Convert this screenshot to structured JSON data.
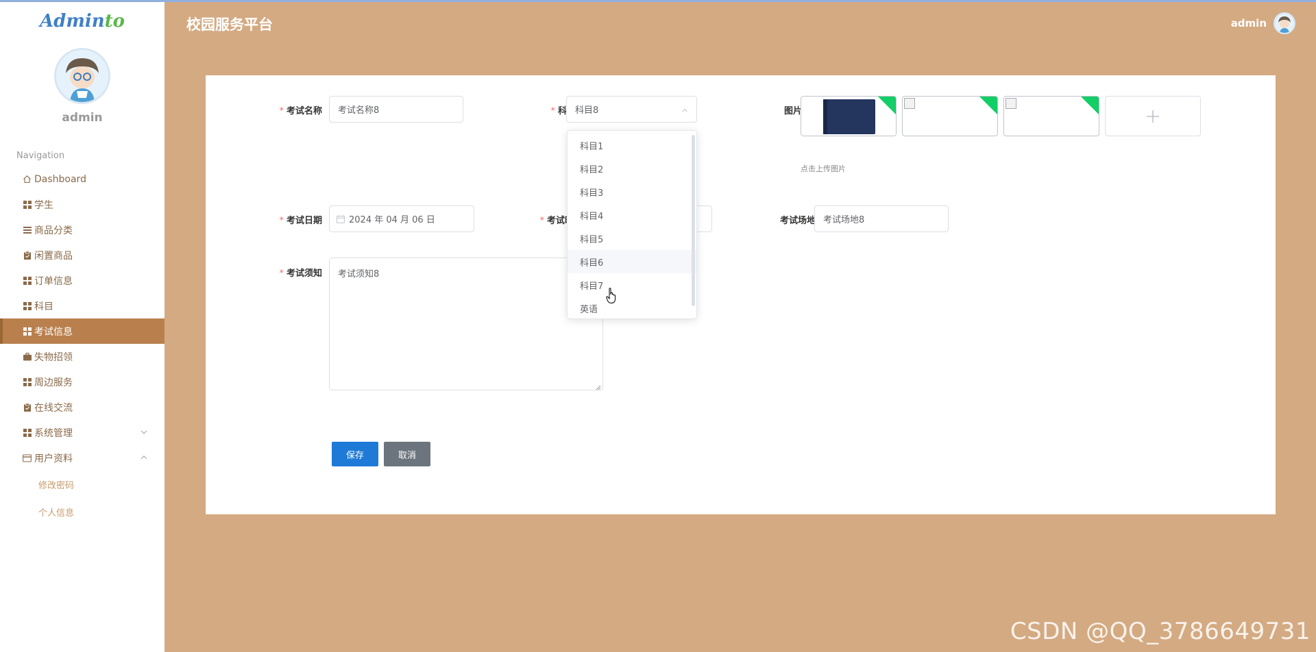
{
  "logo": {
    "main": "Admin",
    "accent": "to"
  },
  "sidebar": {
    "username": "admin",
    "nav_title": "Navigation",
    "items": [
      {
        "label": "Dashboard",
        "icon": "home-icon"
      },
      {
        "label": "学生",
        "icon": "grid-icon"
      },
      {
        "label": "商品分类",
        "icon": "list-icon"
      },
      {
        "label": "闲置商品",
        "icon": "clipboard-icon"
      },
      {
        "label": "订单信息",
        "icon": "grid-icon"
      },
      {
        "label": "科目",
        "icon": "grid-icon"
      },
      {
        "label": "考试信息",
        "icon": "grid-icon",
        "active": true
      },
      {
        "label": "失物招领",
        "icon": "briefcase-icon"
      },
      {
        "label": "周边服务",
        "icon": "grid-icon"
      },
      {
        "label": "在线交流",
        "icon": "clipboard-icon"
      },
      {
        "label": "系统管理",
        "icon": "grid-icon",
        "chevron": "down"
      },
      {
        "label": "用户资料",
        "icon": "card-icon",
        "chevron": "up"
      }
    ],
    "sub_items": [
      "修改密码",
      "个人信息"
    ]
  },
  "header": {
    "title": "校园服务平台",
    "user": "admin"
  },
  "form": {
    "name_label": "考试名称",
    "name_value": "考试名称8",
    "subject_label": "科目",
    "subject_value": "科目8",
    "image_label": "图片",
    "image_hint": "点击上传图片",
    "date_label": "考试日期",
    "date_value": "2024 年 04 月 06 日",
    "time_label": "考试时间",
    "venue_label": "考试场地",
    "venue_value": "考试场地8",
    "notice_label": "考试须知",
    "notice_value": "考试须知8",
    "save_label": "保存",
    "cancel_label": "取消",
    "required_mark": "*"
  },
  "dropdown": {
    "options": [
      "科目1",
      "科目2",
      "科目3",
      "科目4",
      "科目5",
      "科目6",
      "科目7",
      "英语"
    ],
    "hovered": "科目6"
  },
  "colors": {
    "background": "#d4aa82",
    "active_nav": "#b9804e",
    "save_button": "#1e7ad6",
    "cancel_button": "#6c757d",
    "upload_corner": "#13ce66"
  },
  "watermark": "CSDN @QQ_3786649731"
}
